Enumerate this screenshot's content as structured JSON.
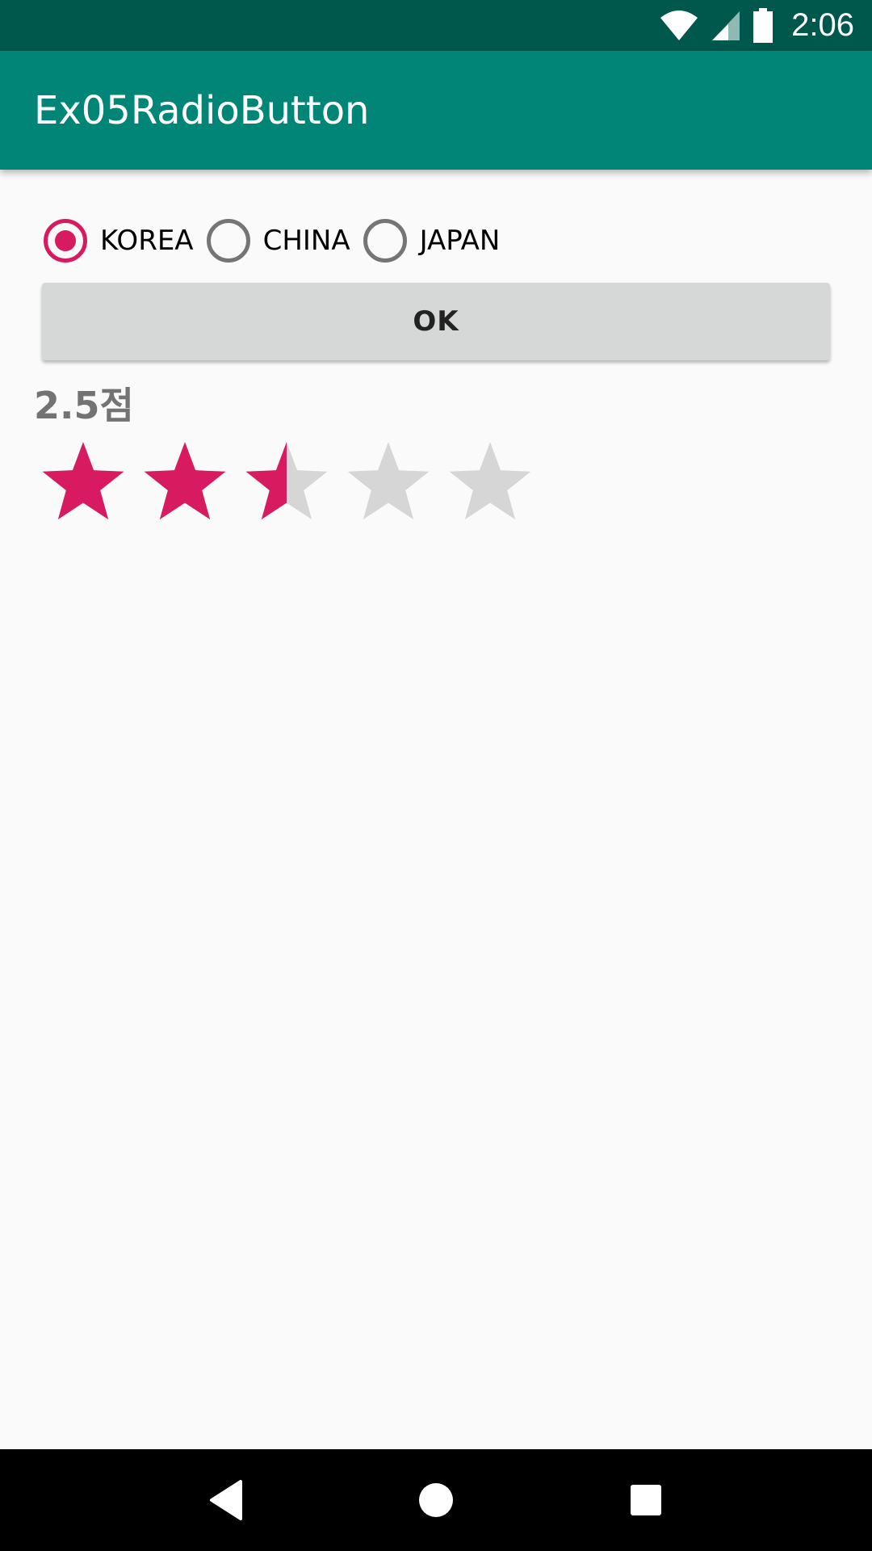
{
  "status_bar": {
    "time": "2:06",
    "icons": [
      "wifi-icon",
      "signal-icon",
      "battery-icon"
    ],
    "bg_color": "#00574b"
  },
  "app_bar": {
    "title": "Ex05RadioButton",
    "bg_color": "#008577"
  },
  "radio_group": {
    "options": [
      {
        "label": "KOREA",
        "checked": true
      },
      {
        "label": "CHINA",
        "checked": false
      },
      {
        "label": "JAPAN",
        "checked": false
      }
    ],
    "accent_color": "#d81b60"
  },
  "ok_button": {
    "label": "OK"
  },
  "score": {
    "text": "2.5점"
  },
  "rating": {
    "value": 2.5,
    "max": 5,
    "filled_color": "#d81b60",
    "empty_color": "#d6d6d6"
  },
  "nav_bar": {
    "buttons": [
      "back-icon",
      "home-icon",
      "recents-icon"
    ]
  }
}
